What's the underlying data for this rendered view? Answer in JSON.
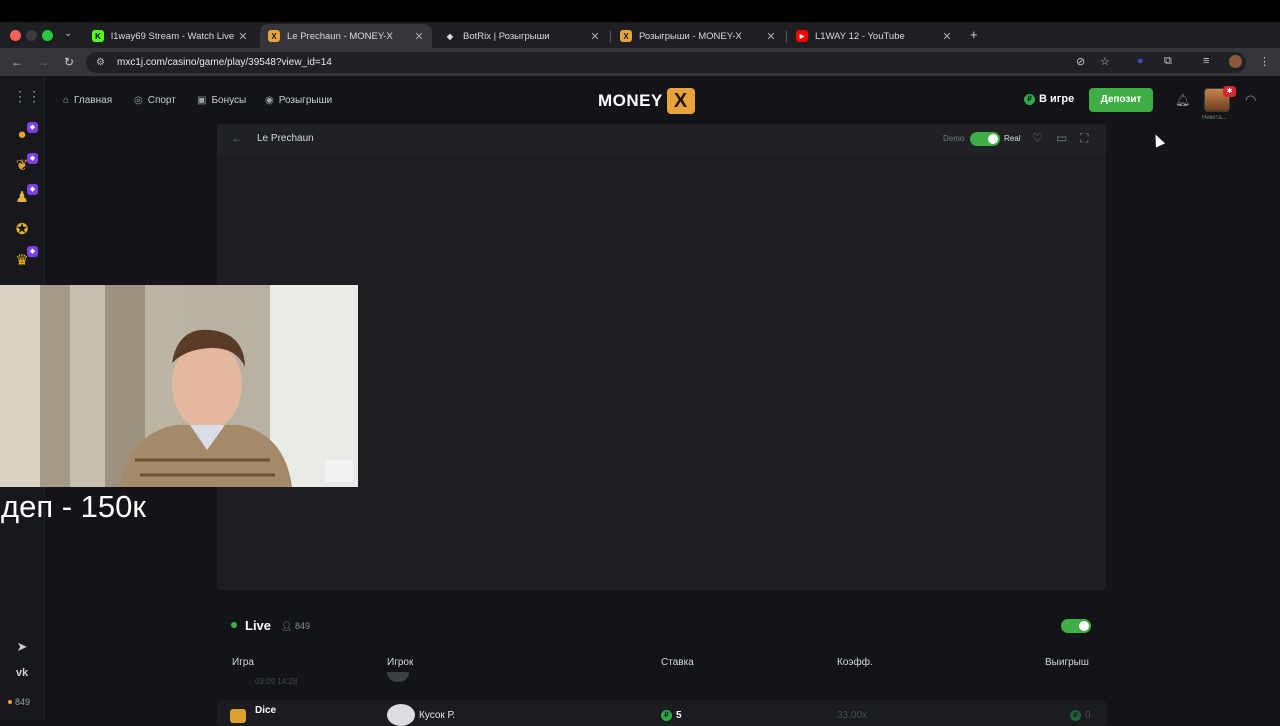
{
  "browser": {
    "tabs": [
      {
        "title": "l1way69 Stream - Watch Live",
        "icon": "kick-icon",
        "color": "#53fc18"
      },
      {
        "title": "Le Prechaun - MONEY-X",
        "icon": "moneyx-icon",
        "color": "#e8a33d"
      },
      {
        "title": "BotRix | Розыгрыши",
        "icon": "botrix-icon",
        "color": "#cccccc"
      },
      {
        "title": "Розыгрыши - MONEY-X",
        "icon": "moneyx-icon",
        "color": "#e8a33d"
      },
      {
        "title": "L1WAY 12 - YouTube",
        "icon": "youtube-icon",
        "color": "#ff0000"
      }
    ],
    "url": "mxc1j.com/casino/game/play/39548?view_id=14"
  },
  "header": {
    "nav": [
      {
        "label": "Главная",
        "icon": "home-icon"
      },
      {
        "label": "Спорт",
        "icon": "sport-icon"
      },
      {
        "label": "Бонусы",
        "icon": "gift-icon"
      },
      {
        "label": "Розыгрыши",
        "icon": "giveaway-icon"
      }
    ],
    "logo_text": "MONEY",
    "logo_x": "X",
    "in_game": "В игре",
    "deposit": "Депозит",
    "username": "Никита..."
  },
  "game": {
    "title": "Le Prechaun",
    "demo": "Demo",
    "real": "Real",
    "mode_real": true
  },
  "overlay": {
    "deposit_caption": "деп - 150к"
  },
  "live": {
    "title": "Live",
    "count": "849",
    "columns": [
      "Игра",
      "Игрок",
      "Ставка",
      "Коэфф.",
      "Выигрыш"
    ],
    "faded_row": {
      "time": "03.09 14:28"
    },
    "row": {
      "game": "Dice",
      "player": "Кусок Р.",
      "bet": "5",
      "coef": "33.00x",
      "win": "0"
    }
  },
  "sidebar": {
    "online": "849"
  },
  "colors": {
    "accent": "#3fae47",
    "brand": "#e8a33d",
    "background": "#121417"
  }
}
